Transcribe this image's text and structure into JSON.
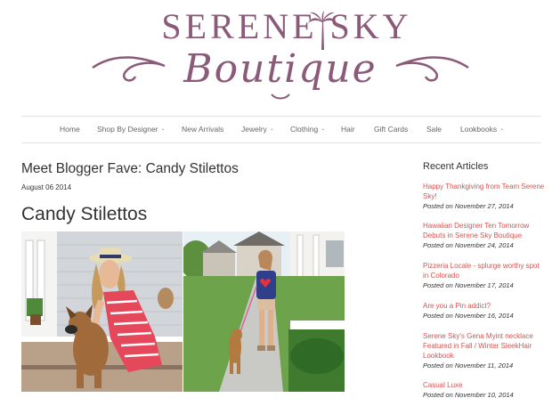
{
  "logo": {
    "top_text": "SERENE SKY",
    "bottom_text": "Boutique",
    "brand_color": "#8a5a78"
  },
  "nav": {
    "items": [
      {
        "label": "Home",
        "caret": false
      },
      {
        "label": "Shop By Designer",
        "caret": true
      },
      {
        "label": "New Arrivals",
        "caret": false
      },
      {
        "label": "Jewelry",
        "caret": true
      },
      {
        "label": "Clothing",
        "caret": true
      },
      {
        "label": "Hair",
        "caret": false
      },
      {
        "label": "Gift Cards",
        "caret": false
      },
      {
        "label": "Sale",
        "caret": false
      },
      {
        "label": "Lookbooks",
        "caret": true
      }
    ]
  },
  "post": {
    "title": "Meet Blogger Fave: Candy Stilettos",
    "date": "August 06 2014",
    "heading": "Candy Stilettos"
  },
  "sidebar": {
    "title": "Recent Articles",
    "link_color": "#d9534f",
    "articles": [
      {
        "title": "Happy Thankgiving from Team Serene Sky!",
        "posted": "Posted on November 27, 2014"
      },
      {
        "title": "Hawaiian Designer Ten Tomorrow Debuts in Serene Sky Boutique",
        "posted": "Posted on November 24, 2014"
      },
      {
        "title": "Pizzeria Locale - splurge worthy spot in Colorado",
        "posted": "Posted on November 17, 2014"
      },
      {
        "title": "Are you a Pin addict?",
        "posted": "Posted on November 16, 2014"
      },
      {
        "title": "Serene Sky's Gena Myint necklace Featured in Fall / Winter SleekHair Lookbook",
        "posted": "Posted on November 11, 2014"
      },
      {
        "title": "Casual Luxe",
        "posted": "Posted on November 10, 2014"
      }
    ]
  }
}
